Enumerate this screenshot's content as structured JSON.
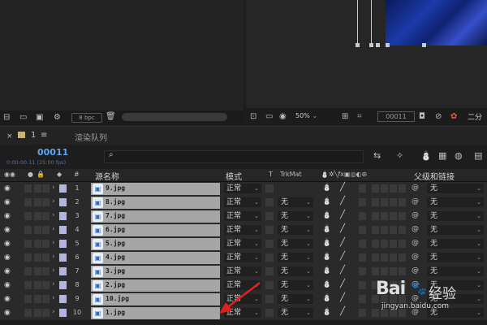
{
  "project_panel": {
    "bpc_label": "8 bpc"
  },
  "viewer": {
    "zoom": "50%",
    "timecode": "00011",
    "view_label": "二分"
  },
  "timeline": {
    "tabs": [
      {
        "label": "1"
      },
      {
        "label": "渲染队列"
      }
    ],
    "timecode": "00011",
    "timecode_sub": "0:00:00:11 (25.00 fps)",
    "headers": {
      "num": "#",
      "source_name": "源名称",
      "mode": "模式",
      "t": "T",
      "trkmat": "TrkMat",
      "parent": "父级和链接"
    },
    "layers": [
      {
        "num": "1",
        "name": "9.jpg",
        "mode": "正常",
        "trkmat": "",
        "parent": "无"
      },
      {
        "num": "2",
        "name": "8.jpg",
        "mode": "正常",
        "trkmat": "无",
        "parent": "无"
      },
      {
        "num": "3",
        "name": "7.jpg",
        "mode": "正常",
        "trkmat": "无",
        "parent": "无"
      },
      {
        "num": "4",
        "name": "6.jpg",
        "mode": "正常",
        "trkmat": "无",
        "parent": "无"
      },
      {
        "num": "5",
        "name": "5.jpg",
        "mode": "正常",
        "trkmat": "无",
        "parent": "无"
      },
      {
        "num": "6",
        "name": "4.jpg",
        "mode": "正常",
        "trkmat": "无",
        "parent": "无"
      },
      {
        "num": "7",
        "name": "3.jpg",
        "mode": "正常",
        "trkmat": "无",
        "parent": "无"
      },
      {
        "num": "8",
        "name": "2.jpg",
        "mode": "正常",
        "trkmat": "无",
        "parent": "无"
      },
      {
        "num": "9",
        "name": "10.jpg",
        "mode": "正常",
        "trkmat": "无",
        "parent": "无"
      },
      {
        "num": "10",
        "name": "1.jpg",
        "mode": "正常",
        "trkmat": "无",
        "parent": "无"
      }
    ]
  },
  "watermark": {
    "brand": "Bai",
    "brand2": "经验",
    "url": "jingyan.baidu.com"
  },
  "colors": {
    "timecode": "#5aa4f0",
    "label": "#b4b4e4",
    "name_bg": "#a6a6a6",
    "arrow": "#e02020"
  }
}
